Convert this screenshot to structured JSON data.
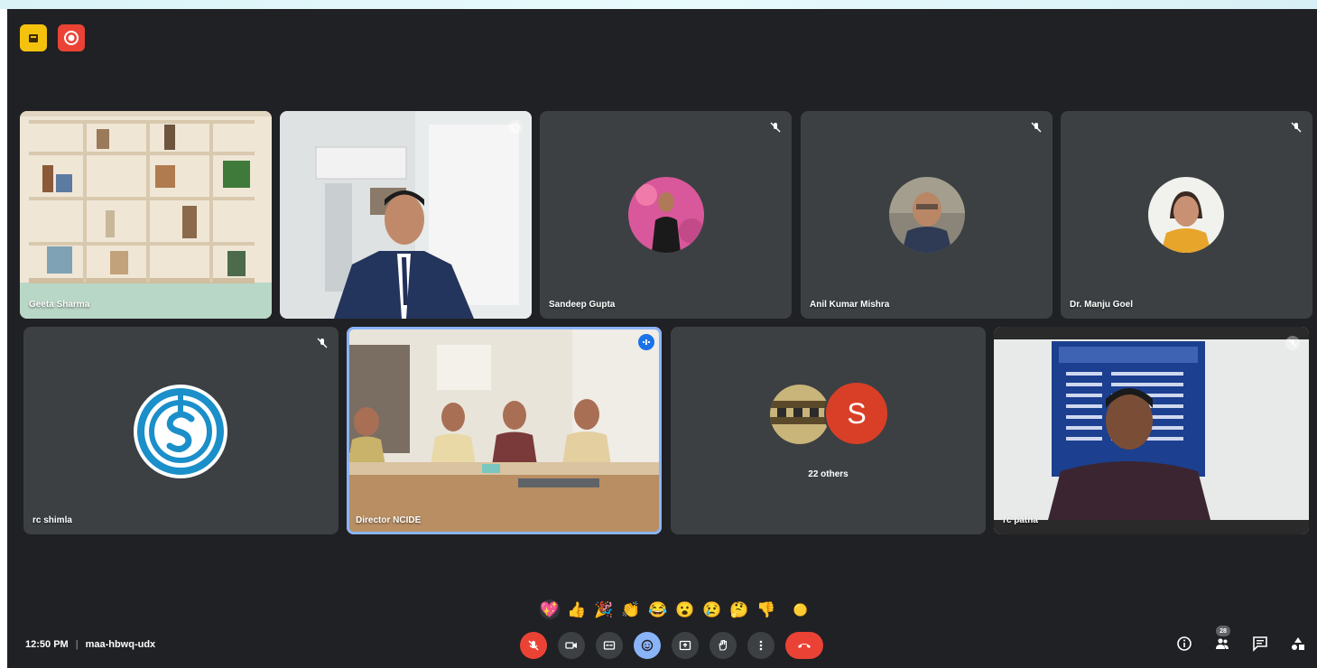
{
  "meeting": {
    "time": "12:50 PM",
    "separator": "|",
    "code": "maa-hbwq-udx"
  },
  "participants": {
    "tile1_name": "Geeta Sharma",
    "tile3_name": "Sandeep Gupta",
    "tile4_name": "Anil Kumar Mishra",
    "tile5_name": "Dr. Manju Goel",
    "tile6_name": "rc shimla",
    "tile7_name": "Director NCIDE",
    "tile8_others": "22 others",
    "tile8_initial": "S",
    "tile9_name": "rc patna"
  },
  "reactions": [
    "💖",
    "👍",
    "🎉",
    "👏",
    "😂",
    "😮",
    "😢",
    "🤔",
    "👎",
    "🟡"
  ],
  "participant_count": "28",
  "colors": {
    "background": "#202124",
    "tile": "#3c4043",
    "accent_red": "#ea4335",
    "accent_blue": "#8ab4f8",
    "badge_yellow": "#f4c20d",
    "avatar_s": "#d93f26"
  },
  "icons": {
    "top_left": [
      "hand-raise-icon",
      "record-icon"
    ],
    "controls": [
      "mic-off-icon",
      "camera-icon",
      "captions-icon",
      "emoji-icon",
      "present-icon",
      "raise-hand-icon",
      "more-options-icon",
      "end-call-icon"
    ],
    "right": [
      "info-icon",
      "people-icon",
      "chat-icon",
      "activities-icon"
    ]
  }
}
